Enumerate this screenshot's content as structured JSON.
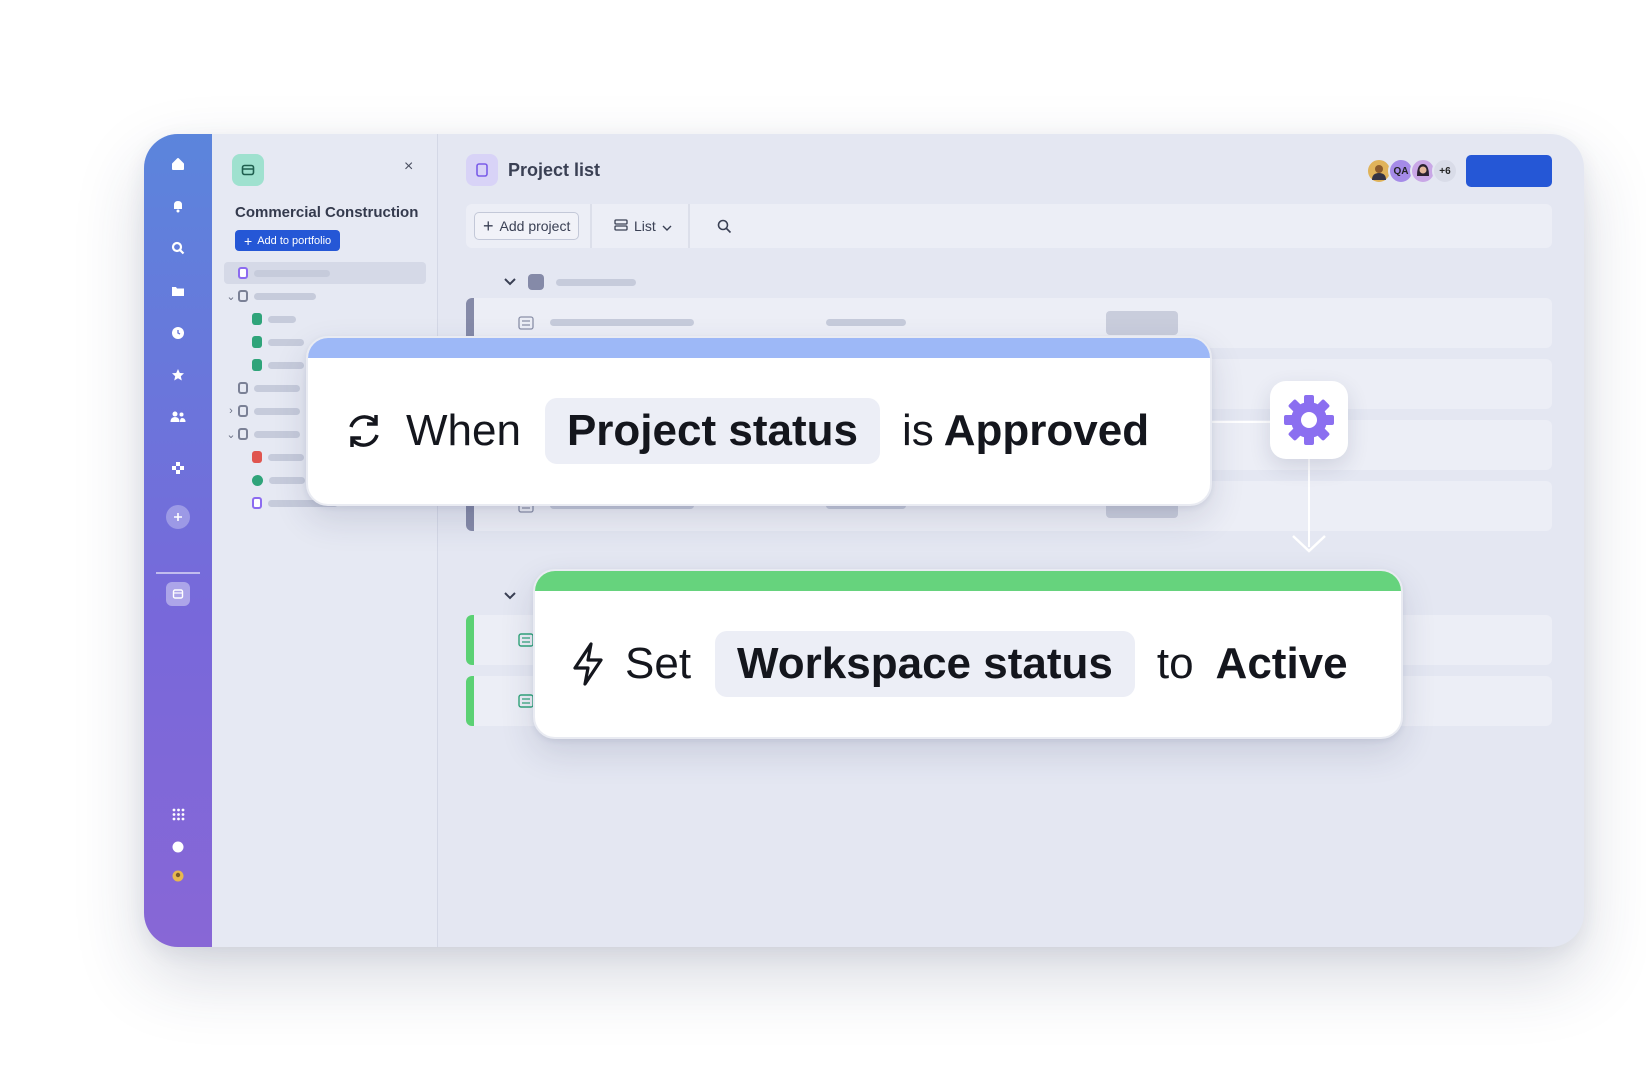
{
  "sidebar": {
    "workspace_name": "Commercial Construction",
    "add_to_portfolio_label": "Add to portfolio",
    "close_label": "×"
  },
  "header": {
    "title": "Project list",
    "avatars": [
      {
        "name": "user-avatar-1",
        "initials": "",
        "color": "#e0b35a"
      },
      {
        "name": "user-avatar-qa",
        "initials": "QA",
        "color": "#a58be8"
      },
      {
        "name": "user-avatar-3",
        "initials": "",
        "color": "#c9a7e6"
      },
      {
        "name": "more-users",
        "initials": "+6",
        "color": "#d9dce8"
      }
    ]
  },
  "toolbar": {
    "add_project_label": "Add project",
    "view_label": "List"
  },
  "automation": {
    "trigger": {
      "keyword": "When",
      "field": "Project status",
      "operator": "is",
      "value": "Approved",
      "bar_color": "#9db8f7"
    },
    "action": {
      "keyword": "Set",
      "field": "Workspace status",
      "operator": "to",
      "value": "Active",
      "bar_color": "#66d37d"
    }
  },
  "colors": {
    "accent": "#2557d6",
    "gear": "#8b6ff0"
  }
}
